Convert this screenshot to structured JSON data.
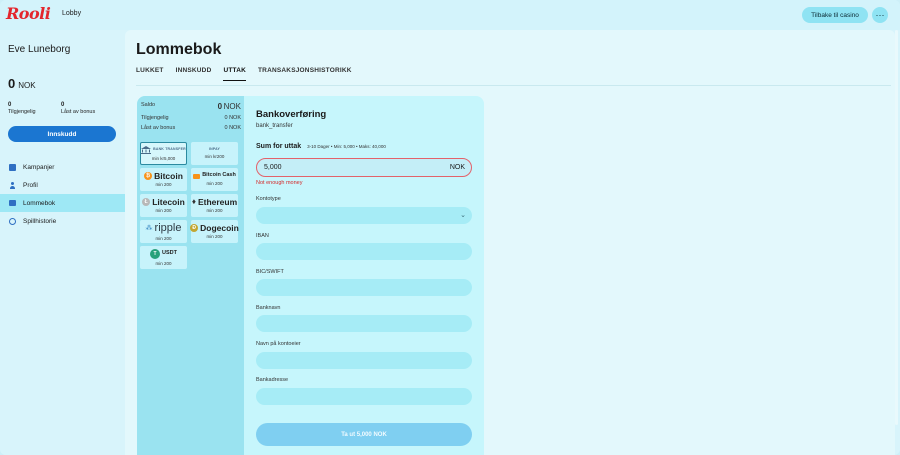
{
  "header": {
    "logo": "Rooli",
    "lobby": "Lobby",
    "back_label": "Tilbake til casino",
    "more_label": "···"
  },
  "sidebar": {
    "user_name": "Eve Luneborg",
    "balance_amount": "0",
    "balance_currency": "NOK",
    "available_value": "0",
    "available_label": "Tilgjengelig",
    "bonus_value": "0",
    "bonus_label": "Låst av bonus",
    "deposit_label": "Innskudd",
    "nav": [
      {
        "label": "Kampanjer",
        "icon": "campaign-icon"
      },
      {
        "label": "Profil",
        "icon": "profile-icon"
      },
      {
        "label": "Lommebok",
        "icon": "wallet-icon",
        "active": true
      },
      {
        "label": "Spillhistorie",
        "icon": "history-icon"
      }
    ]
  },
  "main": {
    "title": "Lommebok",
    "tabs": [
      "LUKKET",
      "INNSKUDD",
      "UTTAK",
      "TRANSAKSJONSHISTORIKK"
    ],
    "active_tab": "UTTAK"
  },
  "balances": {
    "saldo_label": "Saldo",
    "saldo_amount": "0",
    "saldo_currency": "NOK",
    "tilgjengelig_label": "Tilgjengelig",
    "tilgjengelig_value": "0 NOK",
    "bonus_label": "Låst av bonus",
    "bonus_value": "0 NOK"
  },
  "methods": [
    {
      "name": "BANK TRANSFER",
      "min": "min kr5,000",
      "selected": true
    },
    {
      "name": "INPAY",
      "min": "min kr200"
    },
    {
      "name": "Bitcoin",
      "min": "min 200"
    },
    {
      "name": "Bitcoin Cash",
      "min": "min 200"
    },
    {
      "name": "Litecoin",
      "min": "min 200"
    },
    {
      "name": "Ethereum",
      "min": "min 200"
    },
    {
      "name": "ripple",
      "min": "min 200"
    },
    {
      "name": "Dogecoin",
      "min": "min 200"
    },
    {
      "name": "USDT",
      "min": "min 200"
    }
  ],
  "form": {
    "title": "Bankoverføring",
    "subtitle": "bank_transfer",
    "amount_label": "Sum for uttak",
    "amount_info": "3-10 Dager • Min: 5,000 • Maks: 40,000",
    "amount_value": "5,000",
    "amount_currency": "NOK",
    "error": "Not enough money",
    "fields": [
      "Kontotype",
      "IBAN",
      "BIC/SWIFT",
      "Banknavn",
      "Navn på kontoeier",
      "Bankadresse"
    ],
    "submit_label": "Ta ut 5,000 NOK"
  }
}
